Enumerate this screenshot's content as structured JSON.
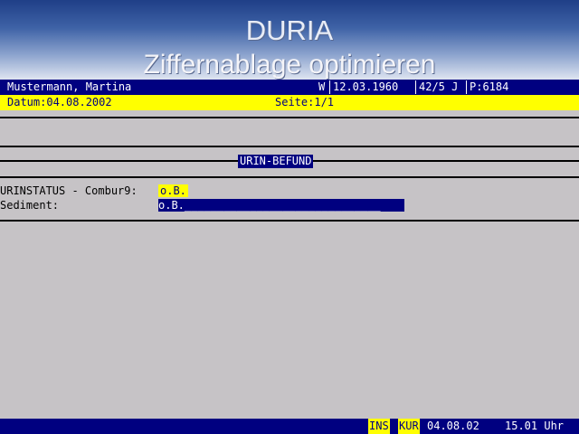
{
  "app": {
    "title": "DURIA",
    "subtitle": "Ziffernablage optimieren"
  },
  "patient": {
    "name": "Mustermann, Martina",
    "sex": "W",
    "birthdate": "12.03.1960",
    "age": "42/5 J",
    "patient_id": "P:6184"
  },
  "info": {
    "datum": "Datum:04.08.2002",
    "seite": "Seite:1/1"
  },
  "section": {
    "title": "URIN-BEFUND"
  },
  "form": {
    "urinstatus_label": "URINSTATUS - Combur9:",
    "urinstatus_value": "o.B.",
    "sediment_label": "Sediment:",
    "sediment_value": "o.B.______________________________"
  },
  "status": {
    "ins": "INS",
    "kur": "KUR",
    "date": "04.08.02",
    "time": "15.01 Uhr"
  },
  "colors": {
    "navy": "#000080",
    "yellow": "#ffff00",
    "background": "#c6c3c6"
  }
}
